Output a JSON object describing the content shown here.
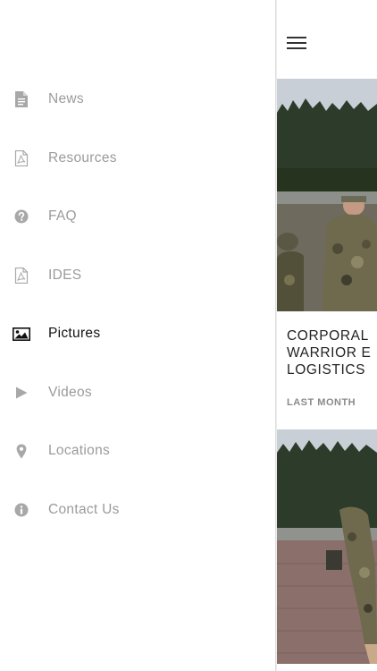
{
  "menu": {
    "items": [
      {
        "label": "News",
        "icon": "document-icon"
      },
      {
        "label": "Resources",
        "icon": "pdf-icon"
      },
      {
        "label": "FAQ",
        "icon": "question-icon"
      },
      {
        "label": "IDES",
        "icon": "pdf-icon"
      },
      {
        "label": "Pictures",
        "icon": "image-icon",
        "active": true
      },
      {
        "label": "Videos",
        "icon": "play-icon"
      },
      {
        "label": "Locations",
        "icon": "location-pin-icon"
      },
      {
        "label": "Contact Us",
        "icon": "info-icon"
      }
    ]
  },
  "feed": {
    "card1": {
      "title": "CORPORAL\nWARRIOR E\nLOGISTICS",
      "date": "LAST MONTH"
    }
  },
  "colors": {
    "inactive_text": "#9b9b9b",
    "active_text": "#111111",
    "icon_inactive": "#a8a8a8",
    "icon_active": "#111111"
  }
}
